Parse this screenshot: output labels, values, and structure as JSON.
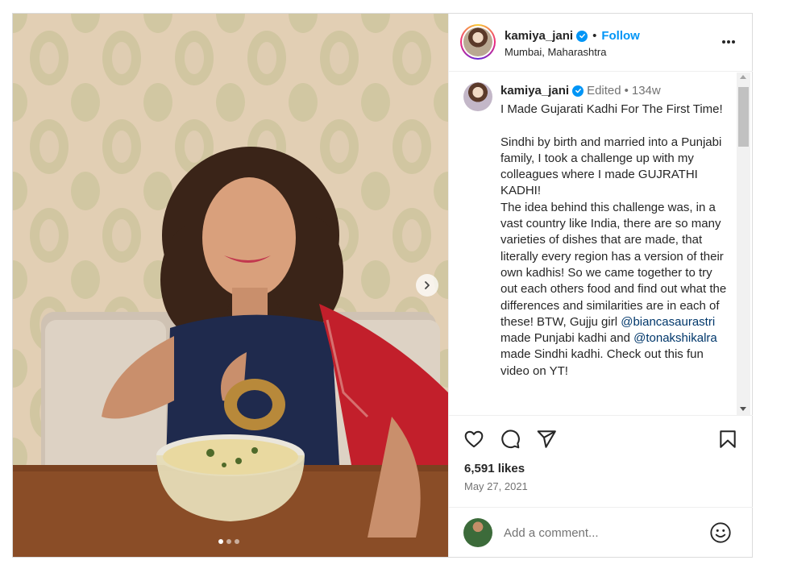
{
  "post": {
    "username": "kamiya_jani",
    "separator": "•",
    "follow_label": "Follow",
    "location": "Mumbai, Maharashtra",
    "carousel": {
      "slide_count": 3,
      "active_index": 0
    }
  },
  "caption": {
    "username": "kamiya_jani",
    "edited_label": "Edited",
    "separator": "•",
    "time": "134w",
    "text_before_mention1": "I Made Gujarati Kadhi For The First Time!\n\nSindhi by birth and married into a Punjabi family, I took a challenge up with my colleagues where I made GUJRATHI KADHI!\nThe idea behind this challenge was, in a vast country like India, there are so many varieties of dishes that are made, that literally every region has a version of their own kadhis! So we came together to try out each others food and find out what the differences and similarities are in each of these! BTW, Gujju girl ",
    "mention1": "@biancasaurastri",
    "text_between": " made Punjabi kadhi and ",
    "mention2": "@tonakshikalra",
    "text_after": " made Sindhi kadhi. Check out this fun video on YT!"
  },
  "stats": {
    "likes": "6,591 likes",
    "date": "May 27, 2021"
  },
  "comment_box": {
    "placeholder": "Add a comment..."
  },
  "icons": {
    "like": "heart-icon",
    "comment": "comment-bubble-icon",
    "share": "paper-plane-icon",
    "save": "bookmark-icon",
    "more": "more-options-icon",
    "emoji": "smiley-icon",
    "verified": "verified-badge-icon",
    "next": "chevron-right-icon"
  },
  "colors": {
    "accent": "#0095f6",
    "mention": "#00376b",
    "muted": "#737373",
    "text": "#262626"
  }
}
